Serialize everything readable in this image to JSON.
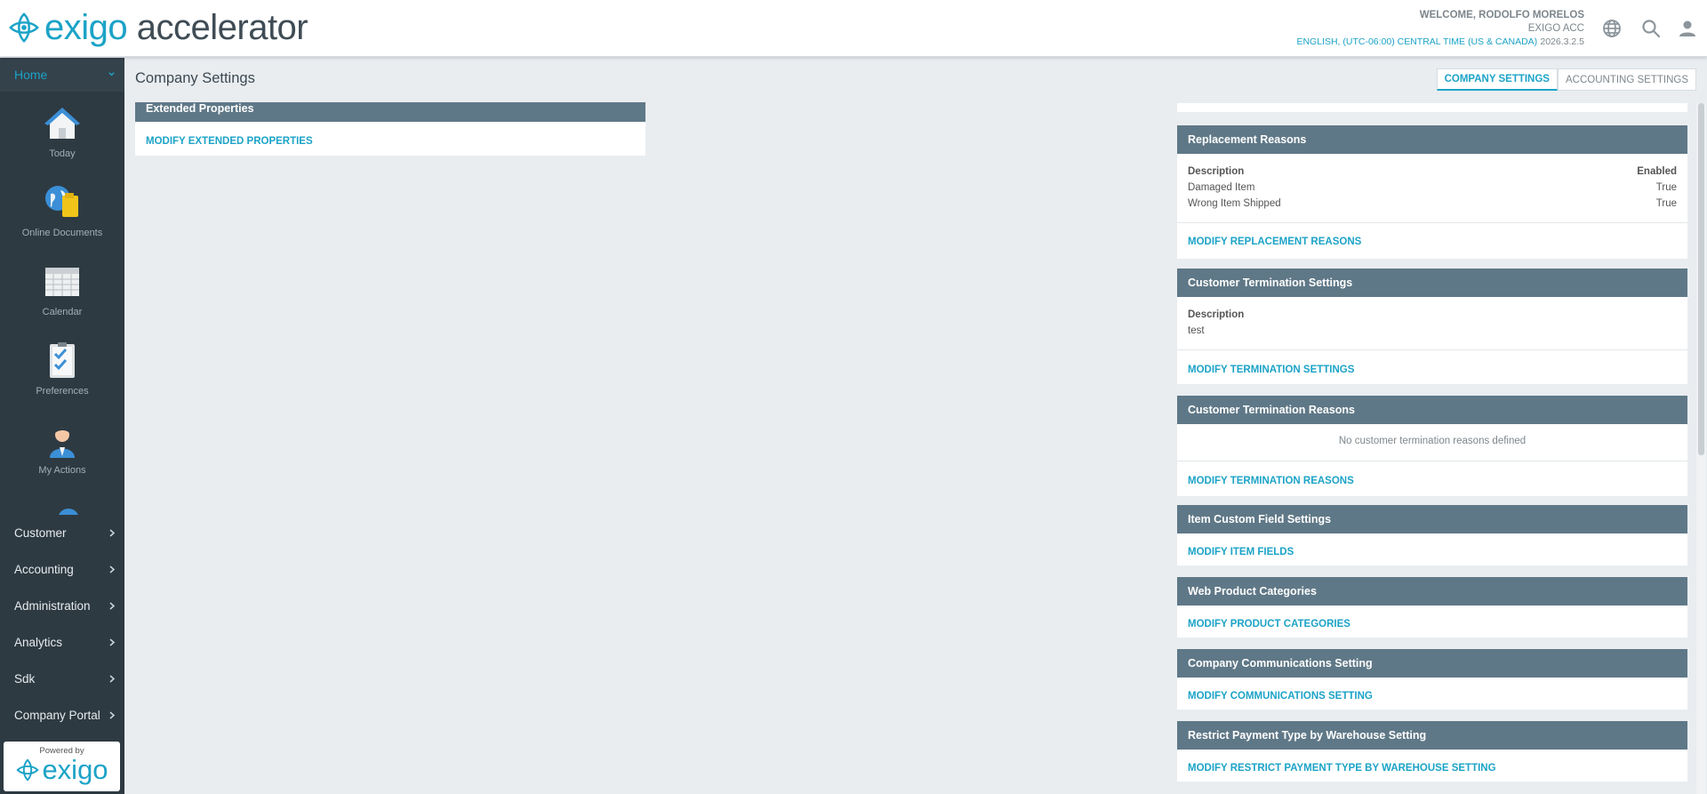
{
  "app": {
    "logo_part1": "exigo",
    "logo_part2": "accelerator",
    "powered_by": "Powered by",
    "powered_logo": "exigo"
  },
  "header": {
    "welcome": "WELCOME, RODOLFO MORELOS",
    "company": "EXIGO ACC",
    "locale": "ENGLISH, (UTC-06:00) CENTRAL TIME (US & CANADA)",
    "version": "2026.3.2.5",
    "icons": [
      "globe-icon",
      "search-icon",
      "user-icon"
    ]
  },
  "sidebar": {
    "home": "Home",
    "tiles": [
      {
        "label": "Today",
        "icon": "house-icon"
      },
      {
        "label": "Online Documents",
        "icon": "globe-folder-icon"
      },
      {
        "label": "Calendar",
        "icon": "calendar-icon"
      },
      {
        "label": "Preferences",
        "icon": "checklist-icon"
      },
      {
        "label": "My Actions",
        "icon": "person-icon"
      }
    ],
    "menu": [
      "Customer",
      "Accounting",
      "Administration",
      "Analytics",
      "Sdk",
      "Company Portal"
    ]
  },
  "main": {
    "title": "Company Settings",
    "tabs": [
      "COMPANY SETTINGS",
      "ACCOUNTING SETTINGS"
    ],
    "left": {
      "extended_title": "Extended Properties",
      "extended_link": "MODIFY EXTENDED PROPERTIES"
    },
    "right": {
      "replacement": {
        "title": "Replacement Reasons",
        "col_desc": "Description",
        "col_enabled": "Enabled",
        "rows": [
          {
            "description": "Damaged Item",
            "enabled": "True"
          },
          {
            "description": "Wrong Item Shipped",
            "enabled": "True"
          }
        ],
        "link": "MODIFY REPLACEMENT REASONS"
      },
      "termination_settings": {
        "title": "Customer Termination Settings",
        "col_desc": "Description",
        "value": "test",
        "link": "MODIFY TERMINATION SETTINGS"
      },
      "termination_reasons": {
        "title": "Customer Termination Reasons",
        "empty": "No customer termination reasons defined",
        "link": "MODIFY TERMINATION REASONS"
      },
      "item_custom": {
        "title": "Item Custom Field Settings",
        "link": "MODIFY ITEM FIELDS"
      },
      "web_categories": {
        "title": "Web Product Categories",
        "link": "MODIFY PRODUCT CATEGORIES"
      },
      "communications": {
        "title": "Company Communications Setting",
        "link": "MODIFY COMMUNICATIONS SETTING"
      },
      "restrict_payment": {
        "title": "Restrict Payment Type by Warehouse Setting",
        "link": "MODIFY RESTRICT PAYMENT TYPE BY WAREHOUSE SETTING"
      }
    }
  },
  "colors": {
    "accent": "#1ca3c7",
    "sidebar": "#2e3a42",
    "panel_header": "#5f7887",
    "background": "#e9edf0"
  }
}
